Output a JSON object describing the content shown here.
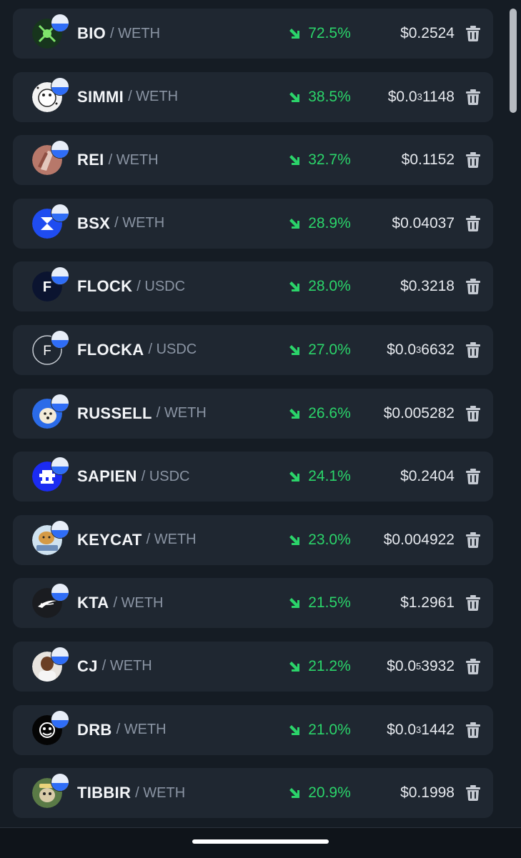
{
  "tokens": [
    {
      "symbol": "BIO",
      "quote": "/ WETH",
      "change": "72.5%",
      "price_pre": "$0.2524",
      "price_sub": "",
      "price_post": "",
      "icon": "bio-token-icon"
    },
    {
      "symbol": "SIMMI",
      "quote": "/ WETH",
      "change": "38.5%",
      "price_pre": "$0.0",
      "price_sub": "3",
      "price_post": "1148",
      "icon": "simmi-token-icon"
    },
    {
      "symbol": "REI",
      "quote": "/ WETH",
      "change": "32.7%",
      "price_pre": "$0.1152",
      "price_sub": "",
      "price_post": "",
      "icon": "rei-token-icon"
    },
    {
      "symbol": "BSX",
      "quote": "/ WETH",
      "change": "28.9%",
      "price_pre": "$0.04037",
      "price_sub": "",
      "price_post": "",
      "icon": "bsx-token-icon"
    },
    {
      "symbol": "FLOCK",
      "quote": "/ USDC",
      "change": "28.0%",
      "price_pre": "$0.3218",
      "price_sub": "",
      "price_post": "",
      "icon": "flock-token-icon"
    },
    {
      "symbol": "FLOCKA",
      "quote": "/ USDC",
      "change": "27.0%",
      "price_pre": "$0.0",
      "price_sub": "3",
      "price_post": "6632",
      "icon": "flocka-token-icon"
    },
    {
      "symbol": "RUSSELL",
      "quote": "/ WETH",
      "change": "26.6%",
      "price_pre": "$0.005282",
      "price_sub": "",
      "price_post": "",
      "icon": "russell-token-icon"
    },
    {
      "symbol": "SAPIEN",
      "quote": "/ USDC",
      "change": "24.1%",
      "price_pre": "$0.2404",
      "price_sub": "",
      "price_post": "",
      "icon": "sapien-token-icon"
    },
    {
      "symbol": "KEYCAT",
      "quote": "/ WETH",
      "change": "23.0%",
      "price_pre": "$0.004922",
      "price_sub": "",
      "price_post": "",
      "icon": "keycat-token-icon"
    },
    {
      "symbol": "KTA",
      "quote": "/ WETH",
      "change": "21.5%",
      "price_pre": "$1.2961",
      "price_sub": "",
      "price_post": "",
      "icon": "kta-token-icon"
    },
    {
      "symbol": "CJ",
      "quote": "/ WETH",
      "change": "21.2%",
      "price_pre": "$0.0",
      "price_sub": "5",
      "price_post": "3932",
      "icon": "cj-token-icon"
    },
    {
      "symbol": "DRB",
      "quote": "/ WETH",
      "change": "21.0%",
      "price_pre": "$0.0",
      "price_sub": "3",
      "price_post": "1442",
      "icon": "drb-token-icon"
    },
    {
      "symbol": "TIBBIR",
      "quote": "/ WETH",
      "change": "20.9%",
      "price_pre": "$0.1998",
      "price_sub": "",
      "price_post": "",
      "icon": "tibbir-token-icon"
    }
  ],
  "colors": {
    "background": "#151c24",
    "row": "#1f2731",
    "positive": "#2bd46a",
    "muted": "#8a94a3"
  }
}
